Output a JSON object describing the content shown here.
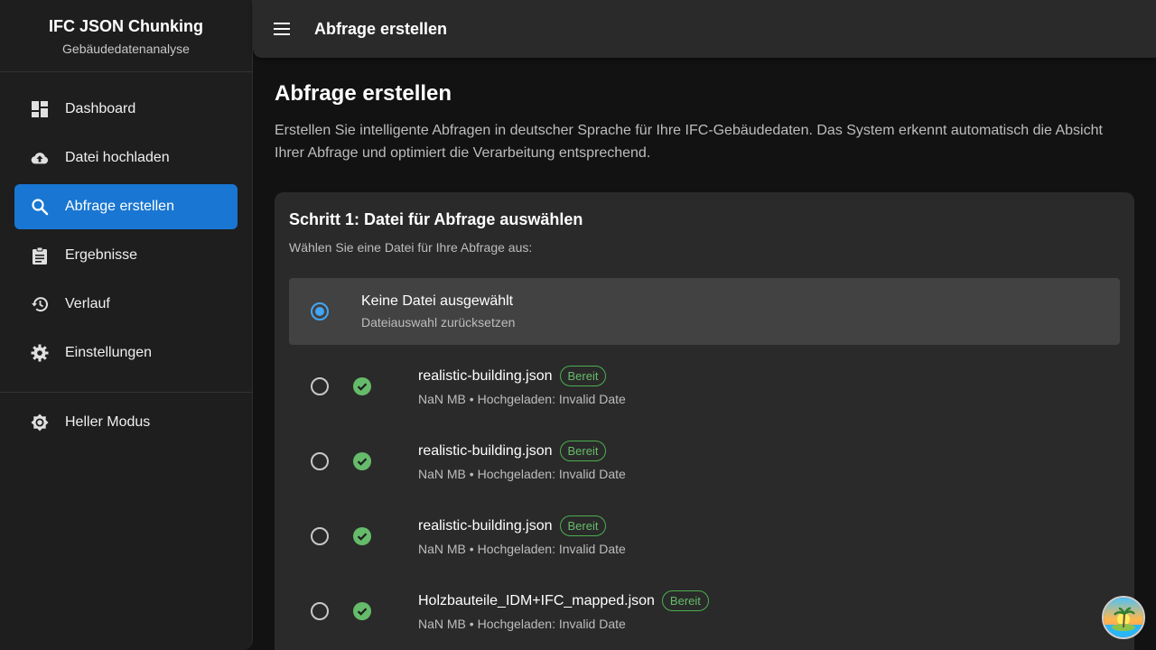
{
  "brand": {
    "title": "IFC JSON Chunking",
    "subtitle": "Gebäudedatenanalyse"
  },
  "nav": {
    "items": [
      {
        "label": "Dashboard",
        "icon": "dashboard-icon"
      },
      {
        "label": "Datei hochladen",
        "icon": "cloud-upload-icon"
      },
      {
        "label": "Abfrage erstellen",
        "icon": "search-icon",
        "active": true
      },
      {
        "label": "Ergebnisse",
        "icon": "clipboard-icon"
      },
      {
        "label": "Verlauf",
        "icon": "history-icon"
      },
      {
        "label": "Einstellungen",
        "icon": "gear-icon"
      }
    ],
    "theme_toggle": {
      "label": "Heller Modus",
      "icon": "brightness-icon"
    }
  },
  "topbar": {
    "title": "Abfrage erstellen"
  },
  "main": {
    "title": "Abfrage erstellen",
    "description": "Erstellen Sie intelligente Abfragen in deutscher Sprache für Ihre IFC-Gebäudedaten. Das System erkennt automatisch die Absicht Ihrer Abfrage und optimiert die Verarbeitung entsprechend."
  },
  "step1": {
    "title": "Schritt 1: Datei für Abfrage auswählen",
    "subtitle": "Wählen Sie eine Datei für Ihre Abfrage aus:",
    "none_option": {
      "title": "Keine Datei ausgewählt",
      "subtitle": "Dateiauswahl zurücksetzen"
    },
    "files": [
      {
        "name": "realistic-building.json",
        "badge": "Bereit",
        "meta": "NaN MB • Hochgeladen: Invalid Date"
      },
      {
        "name": "realistic-building.json",
        "badge": "Bereit",
        "meta": "NaN MB • Hochgeladen: Invalid Date"
      },
      {
        "name": "realistic-building.json",
        "badge": "Bereit",
        "meta": "NaN MB • Hochgeladen: Invalid Date"
      },
      {
        "name": "Holzbauteile_IDM+IFC_mapped.json",
        "badge": "Bereit",
        "meta": "NaN MB • Hochgeladen: Invalid Date"
      }
    ]
  },
  "colors": {
    "accent": "#1976d2",
    "success": "#4caf50",
    "background": "#121212",
    "surface": "#2a2a2a"
  }
}
